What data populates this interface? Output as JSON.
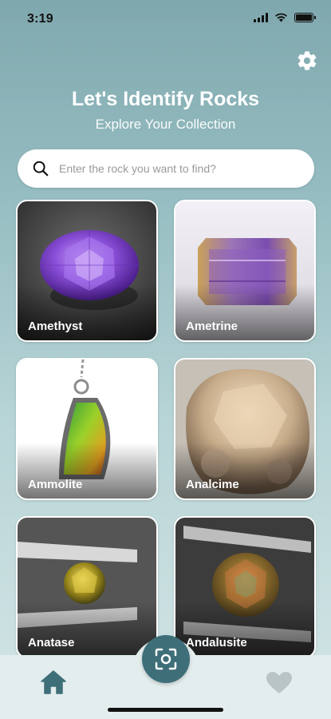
{
  "status": {
    "time": "3:19"
  },
  "header": {
    "title": "Let's Identify Rocks",
    "subtitle": "Explore Your Collection"
  },
  "search": {
    "placeholder": "Enter the rock you want to find?",
    "value": ""
  },
  "rocks": [
    {
      "name": "Amethyst"
    },
    {
      "name": "Ametrine"
    },
    {
      "name": "Ammolite"
    },
    {
      "name": "Analcime"
    },
    {
      "name": "Anatase"
    },
    {
      "name": "Andalusite"
    }
  ],
  "colors": {
    "accent": "#3e6f79",
    "background_top": "#7fa8ae",
    "background_bottom": "#d3e5e6"
  },
  "icons": {
    "settings": "gear-icon",
    "search": "search-icon",
    "home": "home-icon",
    "scan": "scan-icon",
    "favorites": "heart-icon"
  }
}
